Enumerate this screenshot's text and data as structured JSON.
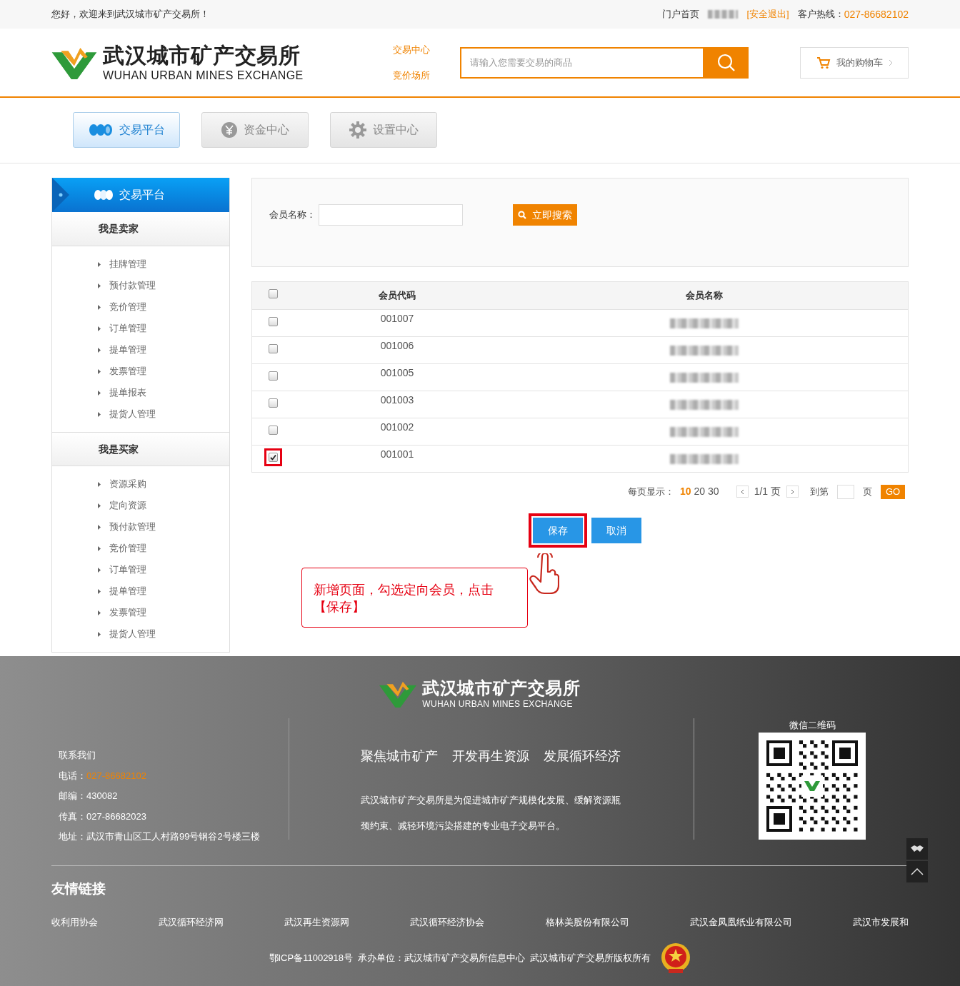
{
  "top_bar": {
    "greeting": "您好，欢迎来到武汉城市矿产交易所！",
    "home_link": "门户首页",
    "logout": "[安全退出]",
    "hotline_label": "客户热线：",
    "hotline": "027-86682102"
  },
  "header": {
    "logo": {
      "name": "武汉城市矿产交易所",
      "subtitle": "WUHAN URBAN MINES EXCHANGE"
    },
    "nav": [
      "交易中心",
      "竞价场所"
    ],
    "search": {
      "placeholder": "请输入您需要交易的商品"
    },
    "cart": "我的购物车"
  },
  "main_tabs": [
    {
      "label": "交易平台",
      "kind": "coins",
      "selected": true
    },
    {
      "label": "资金中心",
      "kind": "yuan",
      "selected": false
    },
    {
      "label": "设置中心",
      "kind": "gear",
      "selected": false
    }
  ],
  "sidebar": {
    "title": "交易平台",
    "sections": [
      {
        "heading": "我是卖家",
        "items": [
          "挂牌管理",
          "预付款管理",
          "竞价管理",
          "订单管理",
          "提单管理",
          "发票管理",
          "提单报表",
          "提货人管理"
        ]
      },
      {
        "heading": "我是买家",
        "items": [
          "资源采购",
          "定向资源",
          "预付款管理",
          "竞价管理",
          "订单管理",
          "提单管理",
          "发票管理",
          "提货人管理"
        ]
      }
    ]
  },
  "search_form": {
    "label": "会员名称：",
    "button": "立即搜索"
  },
  "table": {
    "columns": [
      "会员代码",
      "会员名称"
    ],
    "header_checked": false,
    "rows": [
      {
        "code": "001007",
        "checked": false,
        "highlighted": false
      },
      {
        "code": "001006",
        "checked": false,
        "highlighted": false
      },
      {
        "code": "001005",
        "checked": false,
        "highlighted": false
      },
      {
        "code": "001003",
        "checked": false,
        "highlighted": false
      },
      {
        "code": "001002",
        "checked": false,
        "highlighted": false
      },
      {
        "code": "001001",
        "checked": true,
        "highlighted": true
      }
    ]
  },
  "pager": {
    "label": "每页显示：",
    "sizes": [
      {
        "label": "10",
        "selected": true
      },
      {
        "label": "20",
        "selected": false
      },
      {
        "label": "30",
        "selected": false
      }
    ],
    "page": "1/1 页",
    "goto_label": "到第",
    "goto_suffix": "页",
    "go": "GO"
  },
  "actions": [
    {
      "label": "保存",
      "highlighted": true
    },
    {
      "label": "取消",
      "highlighted": false
    }
  ],
  "callout": "新增页面，勾选定向会员，点击【保存】",
  "footer": {
    "logo": {
      "name": "武汉城市矿产交易所",
      "subtitle": "WUHAN URBAN MINES EXCHANGE"
    },
    "contact": {
      "title": "联系我们",
      "phone_label": "电话：",
      "phone": "027-86682102",
      "lines": [
        "邮编：430082",
        "传真：027-86682023",
        "地址：武汉市青山区工人村路99号钢谷2号楼三楼"
      ]
    },
    "slogans": [
      "聚焦城市矿产",
      "开发再生资源",
      "发展循环经济"
    ],
    "description": "武汉城市矿产交易所是为促进城市矿产规模化发展、缓解资源瓶颈约束、减轻环境污染搭建的专业电子交易平台。",
    "qr_label": "微信二维码",
    "links_title": "友情链接",
    "links": [
      "收利用协会",
      "武汉循环经济网",
      "武汉再生资源网",
      "武汉循环经济协会",
      "格林美股份有限公司",
      "武汉金凤凰纸业有限公司",
      "武汉市发展和"
    ],
    "copyright": "鄂ICP备11002918号  承办单位：武汉城市矿产交易所信息中心  武汉城市矿产交易所版权所有"
  }
}
